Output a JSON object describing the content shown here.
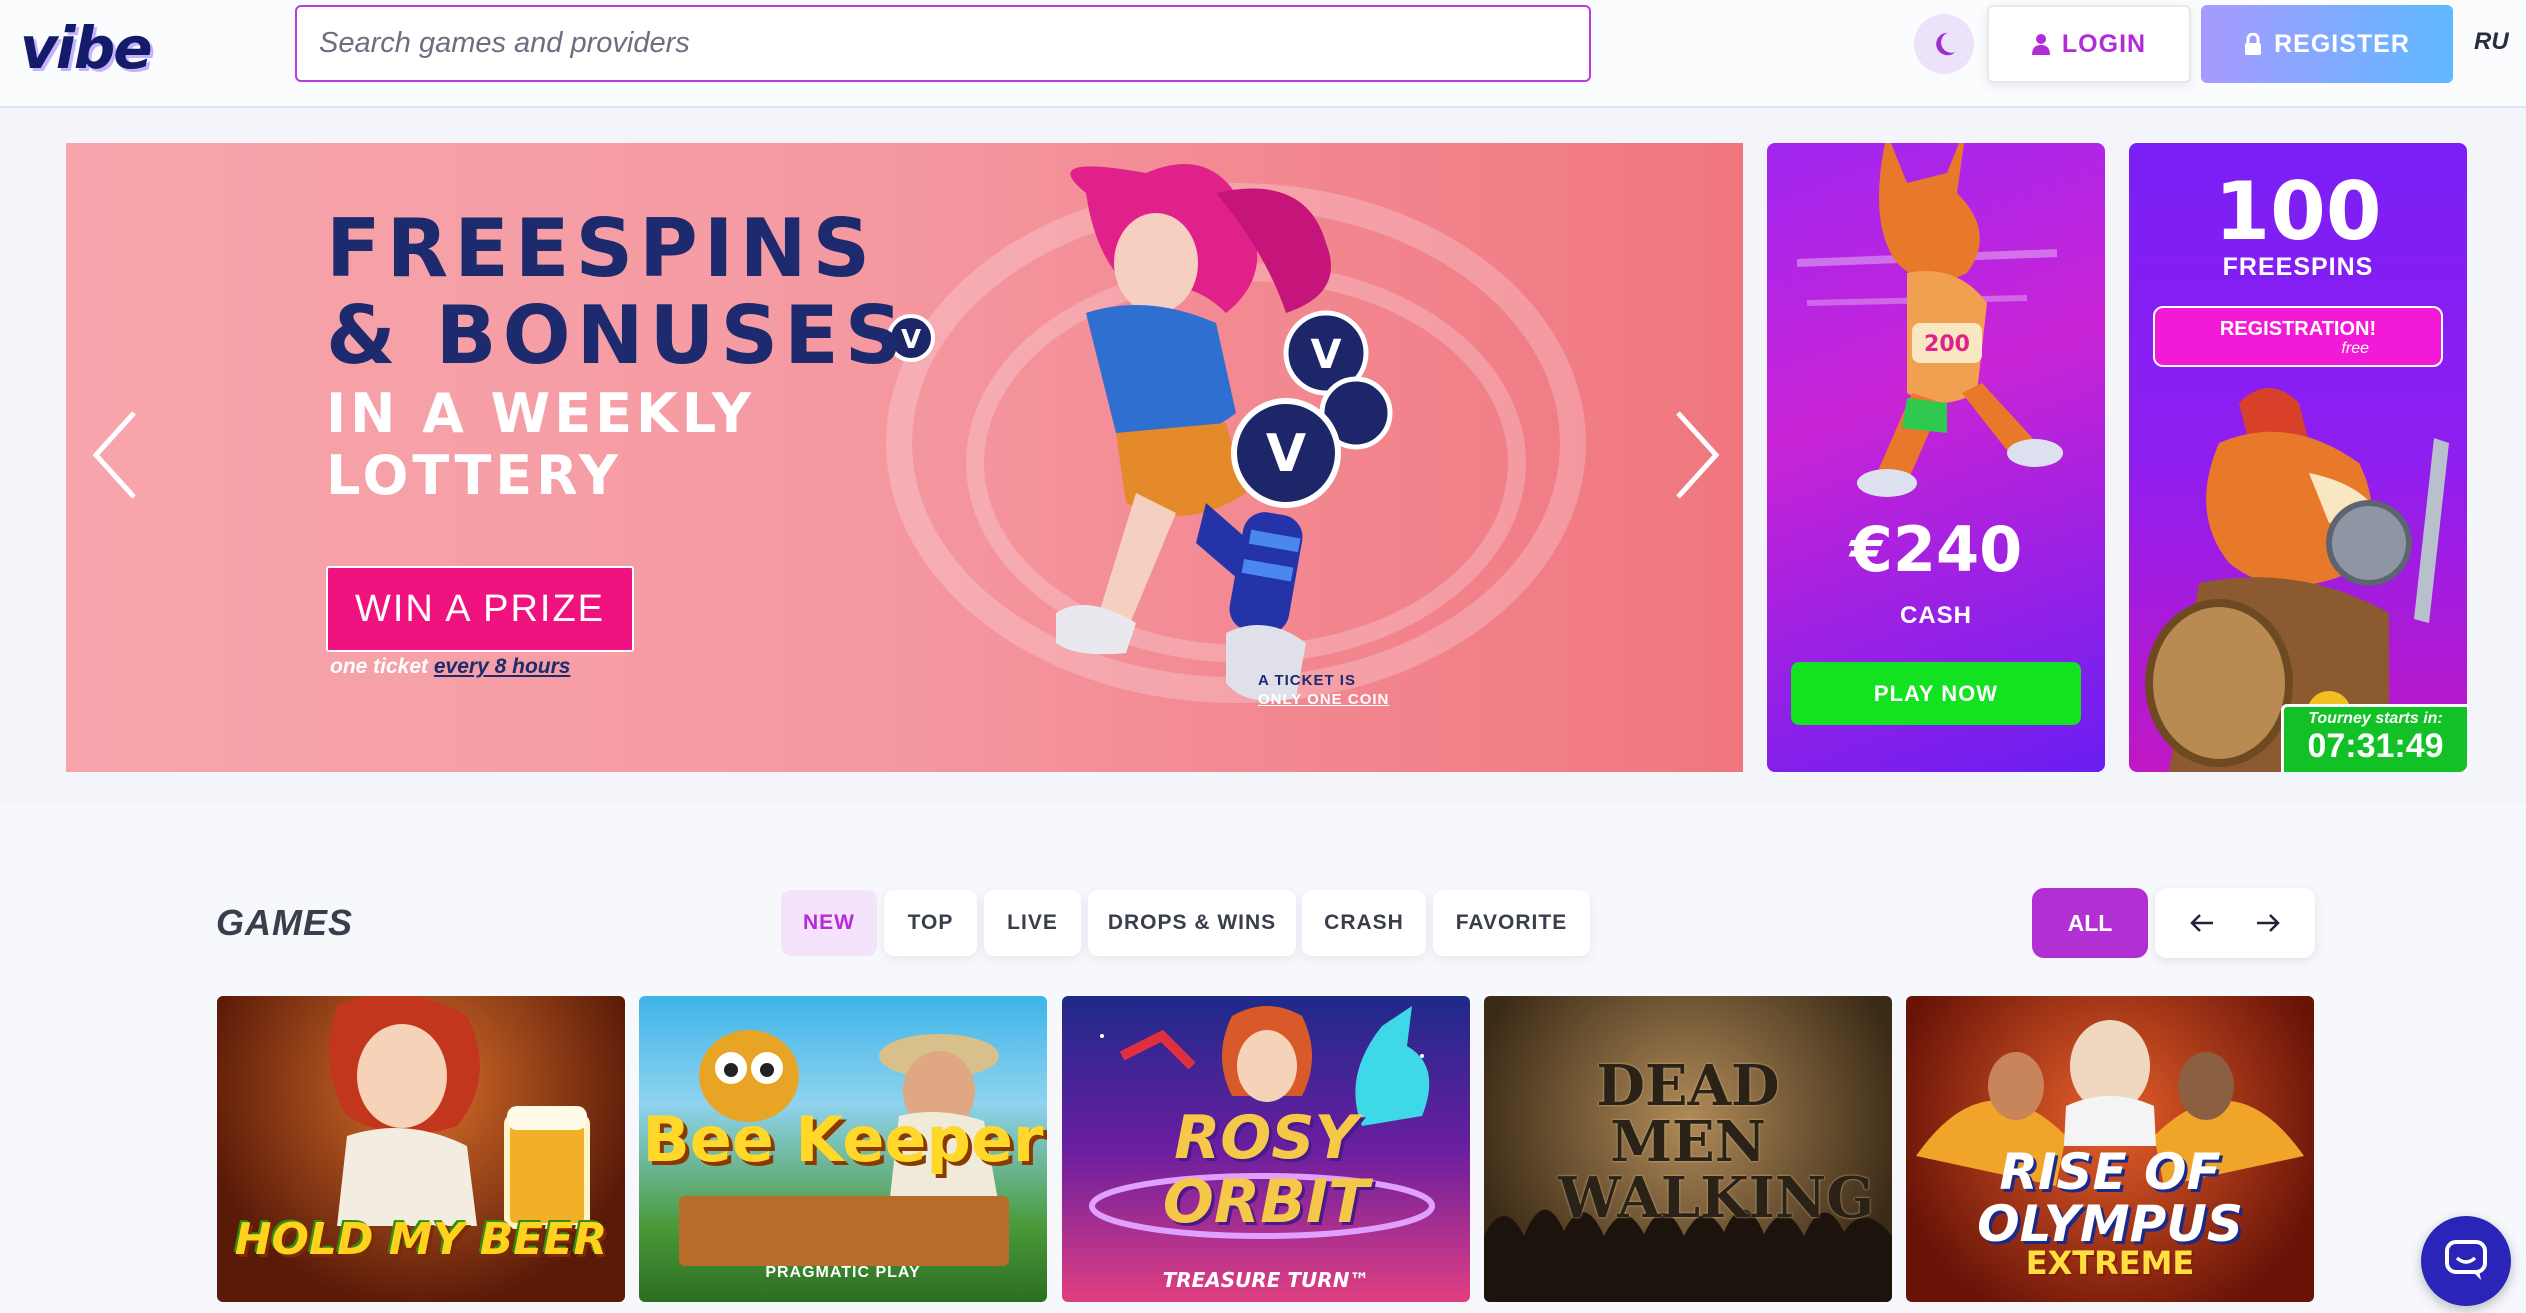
{
  "header": {
    "logo": "vibe",
    "search_placeholder": "Search games and providers",
    "login_label": "LOGIN",
    "register_label": "REGISTER",
    "language": "RU"
  },
  "hero": {
    "title_line1": "FREESPINS",
    "title_line2": "& BONUSES",
    "subtitle_line1": "IN A WEEKLY",
    "subtitle_line2": "LOTTERY",
    "cta_label": "WIN A PRIZE",
    "note_prefix": "one ticket",
    "note_link": "every 8 hours",
    "ticket_line1": "A TICKET IS",
    "ticket_line2": "ONLY ONE COIN"
  },
  "promo_cash": {
    "amount": "€240",
    "label": "CASH",
    "button_label": "PLAY NOW"
  },
  "promo_freespins": {
    "count": "100",
    "label": "FREESPINS",
    "button_label": "REGISTRATION!",
    "button_sub": "free",
    "tourney_label": "Tourney starts in:",
    "countdown": "07:31:49"
  },
  "games": {
    "title": "GAMES",
    "tabs": [
      {
        "label": "NEW",
        "active": true
      },
      {
        "label": "TOP"
      },
      {
        "label": "LIVE"
      },
      {
        "label": "DROPS & WINS"
      },
      {
        "label": "CRASH"
      },
      {
        "label": "FAVORITE"
      }
    ],
    "all_label": "ALL",
    "tiles": [
      {
        "title": "HOLD MY BEER",
        "provider": ""
      },
      {
        "title": "Bee Keeper",
        "provider": "PRAGMATIC PLAY"
      },
      {
        "title": "ROSY ORBIT",
        "sub": "TREASURE TURN™",
        "provider": ""
      },
      {
        "title": "DEAD MEN WALKING",
        "provider": ""
      },
      {
        "title": "RISE OF OLYMPUS",
        "sub": "EXTREME",
        "provider": ""
      }
    ]
  },
  "colors": {
    "accent": "#b22fd4",
    "brand_navy": "#1d2a6e",
    "cta_pink": "#f0127f",
    "green": "#12e21f"
  },
  "icons": [
    "moon-icon",
    "user-icon",
    "lock-icon",
    "chevron-left-icon",
    "chevron-right-icon",
    "arrow-left-icon",
    "arrow-right-icon",
    "chat-icon"
  ]
}
